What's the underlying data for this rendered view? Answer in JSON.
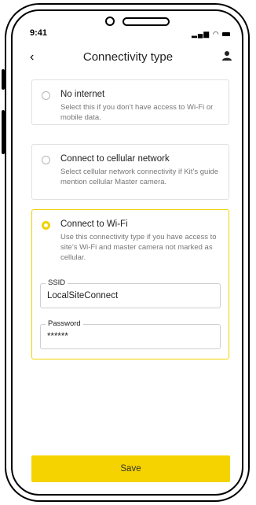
{
  "status_bar": {
    "time": "9:41",
    "signal_icon": "signal-icon",
    "wifi_icon": "wifi-icon",
    "battery_icon": "battery-icon"
  },
  "header": {
    "title": "Connectivity type",
    "back_icon": "chevron-left-icon",
    "profile_icon": "user-icon"
  },
  "options": [
    {
      "title": "No internet",
      "description": "Select this if you don’t have access to Wi-Fi or mobile data.",
      "selected": false
    },
    {
      "title": "Connect to cellular network",
      "description": "Select cellular network connectivity if Kit’s guide mention cellular Master camera.",
      "selected": false
    },
    {
      "title": "Connect to Wi-Fi",
      "description": "Use this connectivity type if you have access to site’s Wi-Fi and master camera not marked as cellular.",
      "selected": true
    }
  ],
  "wifi_form": {
    "ssid_label": "SSID",
    "ssid_value": "LocalSiteConnect",
    "password_label": "Password",
    "password_value": "******"
  },
  "footer": {
    "save_label": "Save"
  },
  "colors": {
    "accent": "#f5d300",
    "selected_border": "#f1d200"
  }
}
